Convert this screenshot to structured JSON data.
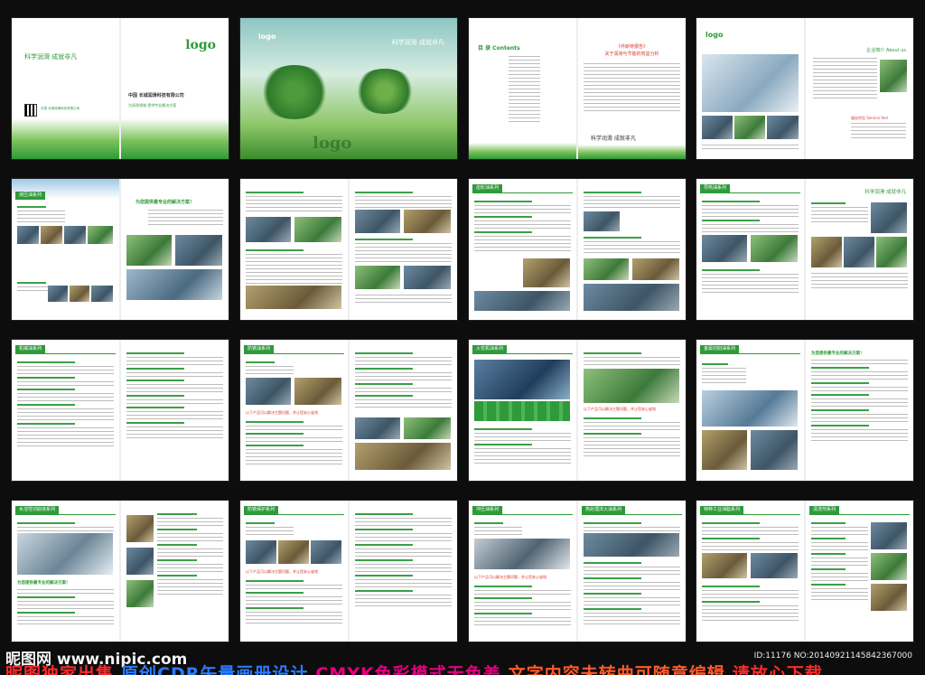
{
  "slogan": "科学润滑 成就非凡",
  "logo": "logo",
  "company_cn": "中国 长城润滑科技有限公司",
  "company_small": "中国 长城润滑科技有限公司",
  "cover_tag": "为润滑领域 提供专业解决方案",
  "contents_title": "目 录 Contents",
  "report_title_1": "《乔斯特报告》",
  "report_title_2": "关于润滑与节能的效益分析",
  "report_slogan": "科学润滑 成就非凡",
  "about_title": "企业简介 About us",
  "service_title": "服务宗旨 Service feel",
  "solution_heading": "为您提供最专业的解决方案！",
  "headers": {
    "hydraulic": "液压油系列",
    "oil2": "油品系列",
    "gear": "齿轮油系列",
    "heat": "导热油系列",
    "machine": "机械油系列",
    "rust": "防锈油系列",
    "special": "火花机油系列",
    "metalcut": "金属切削油系列",
    "water": "水溶性切削液系列",
    "rustproof": "防锈保护系列",
    "punch": "冲压油系列",
    "heattreat": "热处理淬火油系列",
    "grease": "特种工业油脂系列",
    "clean": "清洗剂系列"
  },
  "highlight_red": "以下产品可以解决主题问题，并让您安心省钱",
  "watermark_site": "昵图网 www.nipic.com",
  "watermark_bottom": [
    "昵图独家出售",
    "原创CDR矢量画册设计",
    "CMYK色彩模式无色差",
    "文字内容未转曲可随意编辑",
    "请放心下载"
  ],
  "image_id": "ID:11176 NO:20140921145842367000",
  "colors": {
    "green": "#2f9a3a",
    "light_green": "#7cc25a",
    "magenta": "#e4007f",
    "red": "#d63b2c"
  }
}
